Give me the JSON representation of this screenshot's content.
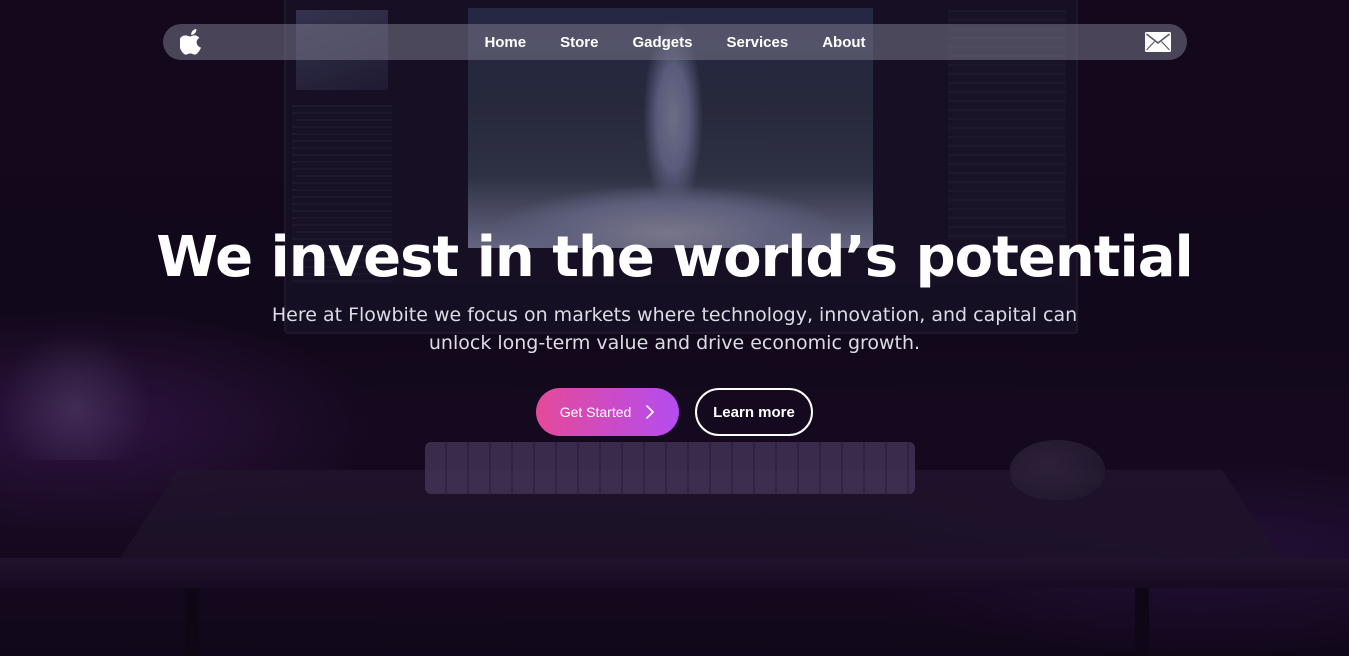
{
  "navbar": {
    "logo_icon": "apple-icon",
    "links": [
      {
        "label": "Home"
      },
      {
        "label": "Store"
      },
      {
        "label": "Gadgets"
      },
      {
        "label": "Services"
      },
      {
        "label": "About"
      }
    ],
    "mail_icon": "envelope-icon"
  },
  "hero": {
    "headline": "We invest in the world’s potential",
    "subtext": "Here at Flowbite we focus on markets where technology, innovation, and capital can unlock long-term value and drive economic growth.",
    "primary_button": {
      "label": "Get Started",
      "icon": "chevron-right-icon"
    },
    "secondary_button": {
      "label": "Learn more"
    }
  },
  "colors": {
    "gradient_start": "#e54a9a",
    "gradient_end": "#b44cf0",
    "nav_background": "#78768a",
    "text": "#ffffff"
  }
}
